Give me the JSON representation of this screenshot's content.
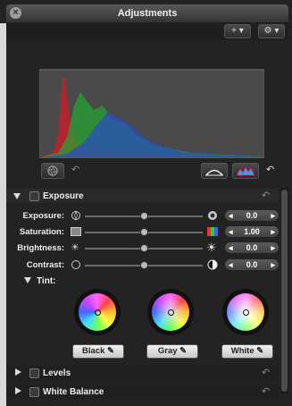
{
  "window": {
    "title": "Adjustments"
  },
  "toolbar": {
    "add_label": "+ ▾",
    "gear_label": "⚙ ▾"
  },
  "exposure": {
    "header": "Exposure",
    "rows": [
      {
        "label": "Exposure:",
        "value": "0.0",
        "level": 0.5
      },
      {
        "label": "Saturation:",
        "value": "1.00",
        "level": 0.5
      },
      {
        "label": "Brightness:",
        "value": "0.0",
        "level": 0.5
      },
      {
        "label": "Contrast:",
        "value": "0.0",
        "level": 0.5
      }
    ],
    "tint_label": "Tint:",
    "tint_buttons": [
      "Black",
      "Gray",
      "White"
    ]
  },
  "sections": [
    {
      "label": "Levels"
    },
    {
      "label": "White Balance"
    }
  ],
  "icons": {
    "close": "close-icon",
    "aperture": "aperture-icon",
    "undo": "undo-arrow-icon",
    "levels": "auto-levels-icon",
    "color_levels": "auto-color-levels-icon"
  },
  "colors": {
    "accent_red": "#cc2222",
    "accent_green": "#22aa22",
    "accent_blue": "#2244cc"
  }
}
